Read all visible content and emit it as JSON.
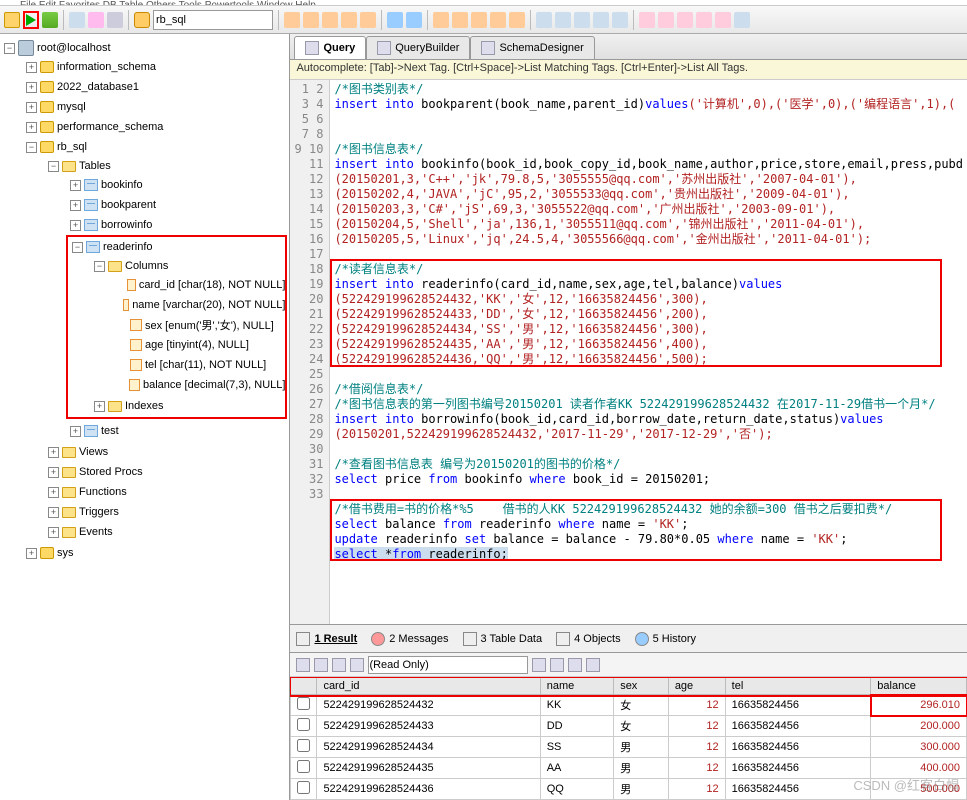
{
  "menubar": "File  Edit  Favorites  DB  Table  Others  Tools  Powertools  Window  Help",
  "combo": {
    "value": "rb_sql"
  },
  "tree": {
    "root": "root@localhost",
    "dbs": [
      "information_schema",
      "2022_database1",
      "mysql",
      "performance_schema"
    ],
    "rb": "rb_sql",
    "tables_label": "Tables",
    "tables": [
      "bookinfo",
      "bookparent",
      "borrowinfo"
    ],
    "readerinfo": "readerinfo",
    "columns_label": "Columns",
    "cols": [
      "card_id [char(18), NOT NULL]",
      "name [varchar(20), NOT NULL]",
      "sex [enum('男','女'), NULL]",
      "age [tinyint(4), NULL]",
      "tel [char(11), NOT NULL]",
      "balance [decimal(7,3), NULL]"
    ],
    "indexes_label": "Indexes",
    "test": "test",
    "folders": [
      "Views",
      "Stored Procs",
      "Functions",
      "Triggers",
      "Events"
    ],
    "sys": "sys"
  },
  "tabs": {
    "query": "Query",
    "builder": "QueryBuilder",
    "schema": "SchemaDesigner"
  },
  "autocomplete": "Autocomplete:  [Tab]->Next Tag.  [Ctrl+Space]->List Matching Tags.  [Ctrl+Enter]->List All Tags.",
  "sql": {
    "lines": 33,
    "l1": "/*图书类别表*/",
    "l2a": "insert into ",
    "l2b": "bookparent(book_name,parent_id)",
    "l2c": "values",
    "l2d": "('计算机',0),('医学',0),('编程语言',1),(",
    "l5": "/*图书信息表*/",
    "l6a": "insert into ",
    "l6b": "bookinfo(book_id,book_copy_id,book_name,author,price,store,email,press,pubd",
    "l6c": "",
    "l7": "(20150201,3,'C++','jk',79.8,5,'3055555@qq.com','苏州出版社','2007-04-01'),",
    "l8": "(20150202,4,'JAVA','jC',95,2,'3055533@qq.com','贵州出版社','2009-04-01'),",
    "l9": "(20150203,3,'C#','jS',69,3,'3055522@qq.com','广州出版社','2003-09-01'),",
    "l10": "(20150204,5,'Shell','ja',136,1,'3055511@qq.com','锦州出版社','2011-04-01'),",
    "l11": "(20150205,5,'Linux','jq',24.5,4,'3055566@qq.com','金州出版社','2011-04-01');",
    "l13": "/*读者信息表*/",
    "l14a": "insert into ",
    "l14b": "readerinfo(card_id,name,sex,age,tel,balance)",
    "l14c": "values",
    "l15": "(522429199628524432,'KK','女',12,'16635824456',300),",
    "l16": "(522429199628524433,'DD','女',12,'16635824456',200),",
    "l17": "(522429199628524434,'SS','男',12,'16635824456',300),",
    "l18": "(522429199628524435,'AA','男',12,'16635824456',400),",
    "l19": "(522429199628524436,'QQ','男',12,'16635824456',500);",
    "l21": "/*借阅信息表*/",
    "l22": "/*图书信息表的第一列图书编号20150201 读者作者KK 522429199628524432 在2017-11-29借书一个月*/",
    "l23a": "insert into ",
    "l23b": "borrowinfo(book_id,card_id,borrow_date,return_date,status)",
    "l23c": "values",
    "l24": "(20150201,522429199628524432,'2017-11-29','2017-12-29','否');",
    "l26": "/*查看图书信息表 编号为20150201的图书的价格*/",
    "l27a": "select ",
    "l27b": "price ",
    "l27c": "from ",
    "l27d": "bookinfo ",
    "l27e": "where ",
    "l27f": "book_id = 20150201;",
    "l29": "/*借书费用=书的价格*%5    借书的人KK 522429199628524432 她的余额=300 借书之后要扣费*/",
    "l30a": "select ",
    "l30b": "balance ",
    "l30c": "from ",
    "l30d": "readerinfo ",
    "l30e": "where ",
    "l30f": "name = ",
    "l30g": "'KK'",
    "l30h": ";",
    "l31a": "update ",
    "l31b": "readerinfo ",
    "l31c": "set ",
    "l31d": "balance = balance - 79.80*0.05 ",
    "l31e": "where ",
    "l31f": "name = ",
    "l31g": "'KK'",
    "l31h": ";",
    "l32a": "select ",
    "l32b": "*",
    "l32c": "from ",
    "l32d": "readerinfo;",
    "l32_full": "select *from readerinfo;"
  },
  "resultTabs": {
    "r1": "1  Result",
    "r2": "2  Messages",
    "r3": "3  Table Data",
    "r4": "4  Objects",
    "r5": "5  History"
  },
  "readonly": "(Read Only)",
  "grid": {
    "headers": [
      "card_id",
      "name",
      "sex",
      "age",
      "tel",
      "balance"
    ],
    "rows": [
      {
        "card_id": "522429199628524432",
        "name": "KK",
        "sex": "女",
        "age": "12",
        "tel": "16635824456",
        "balance": "296.010"
      },
      {
        "card_id": "522429199628524433",
        "name": "DD",
        "sex": "女",
        "age": "12",
        "tel": "16635824456",
        "balance": "200.000"
      },
      {
        "card_id": "522429199628524434",
        "name": "SS",
        "sex": "男",
        "age": "12",
        "tel": "16635824456",
        "balance": "300.000"
      },
      {
        "card_id": "522429199628524435",
        "name": "AA",
        "sex": "男",
        "age": "12",
        "tel": "16635824456",
        "balance": "400.000"
      },
      {
        "card_id": "522429199628524436",
        "name": "QQ",
        "sex": "男",
        "age": "12",
        "tel": "16635824456",
        "balance": "500.000"
      }
    ]
  },
  "watermark": "CSDN @红客白帽"
}
